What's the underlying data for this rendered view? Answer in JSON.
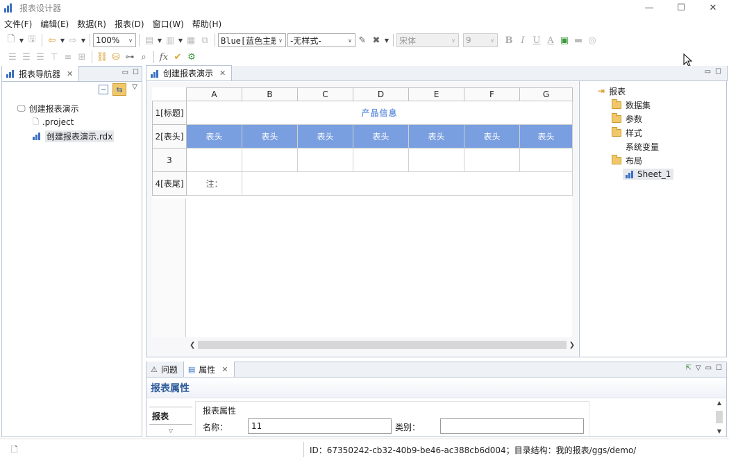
{
  "window": {
    "title": "报表设计器"
  },
  "menu": [
    "文件(F)",
    "编辑(E)",
    "数据(R)",
    "报表(D)",
    "窗口(W)",
    "帮助(H)"
  ],
  "toolbar": {
    "zoom": "100%",
    "theme": "Blue[蓝色主题",
    "style": "-无样式-",
    "font": "宋体",
    "font_size": "9",
    "fx_label": "fx"
  },
  "navigator": {
    "tab_label": "报表导航器",
    "project_name": "创建报表演示",
    "files": [
      ".project",
      "创建报表演示.rdx"
    ]
  },
  "editor": {
    "tab_label": "创建报表演示",
    "columns": [
      "A",
      "B",
      "C",
      "D",
      "E",
      "F",
      "G"
    ],
    "rows": [
      {
        "label": "1[标题]",
        "title": "产品信息"
      },
      {
        "label": "2[表头]",
        "cells": [
          "表头",
          "表头",
          "表头",
          "表头",
          "表头",
          "表头",
          "表头"
        ]
      },
      {
        "label": "3"
      },
      {
        "label": "4[表尾]",
        "note": "注："
      }
    ]
  },
  "outline": {
    "root": "报表",
    "items": [
      "数据集",
      "参数",
      "样式",
      "系统变量",
      "布局"
    ],
    "sheet": "Sheet_1"
  },
  "bottom": {
    "tabs": [
      "问题",
      "属性"
    ],
    "header": "报表属性",
    "side_tab": "报表",
    "group_label": "报表属性",
    "name_label": "名称：",
    "name_value": "11",
    "category_label": "类别：",
    "category_value": ""
  },
  "status": {
    "message": "ID：67350242-cb32-40b9-be46-ac388cb6d004；目录结构：我的报表/ggs/demo/"
  },
  "colors": {
    "header_fill": "#7a9fe0",
    "title_text": "#6f9ae0",
    "accent_blue": "#2d5a9a",
    "panel_border": "#b8c4d4"
  }
}
